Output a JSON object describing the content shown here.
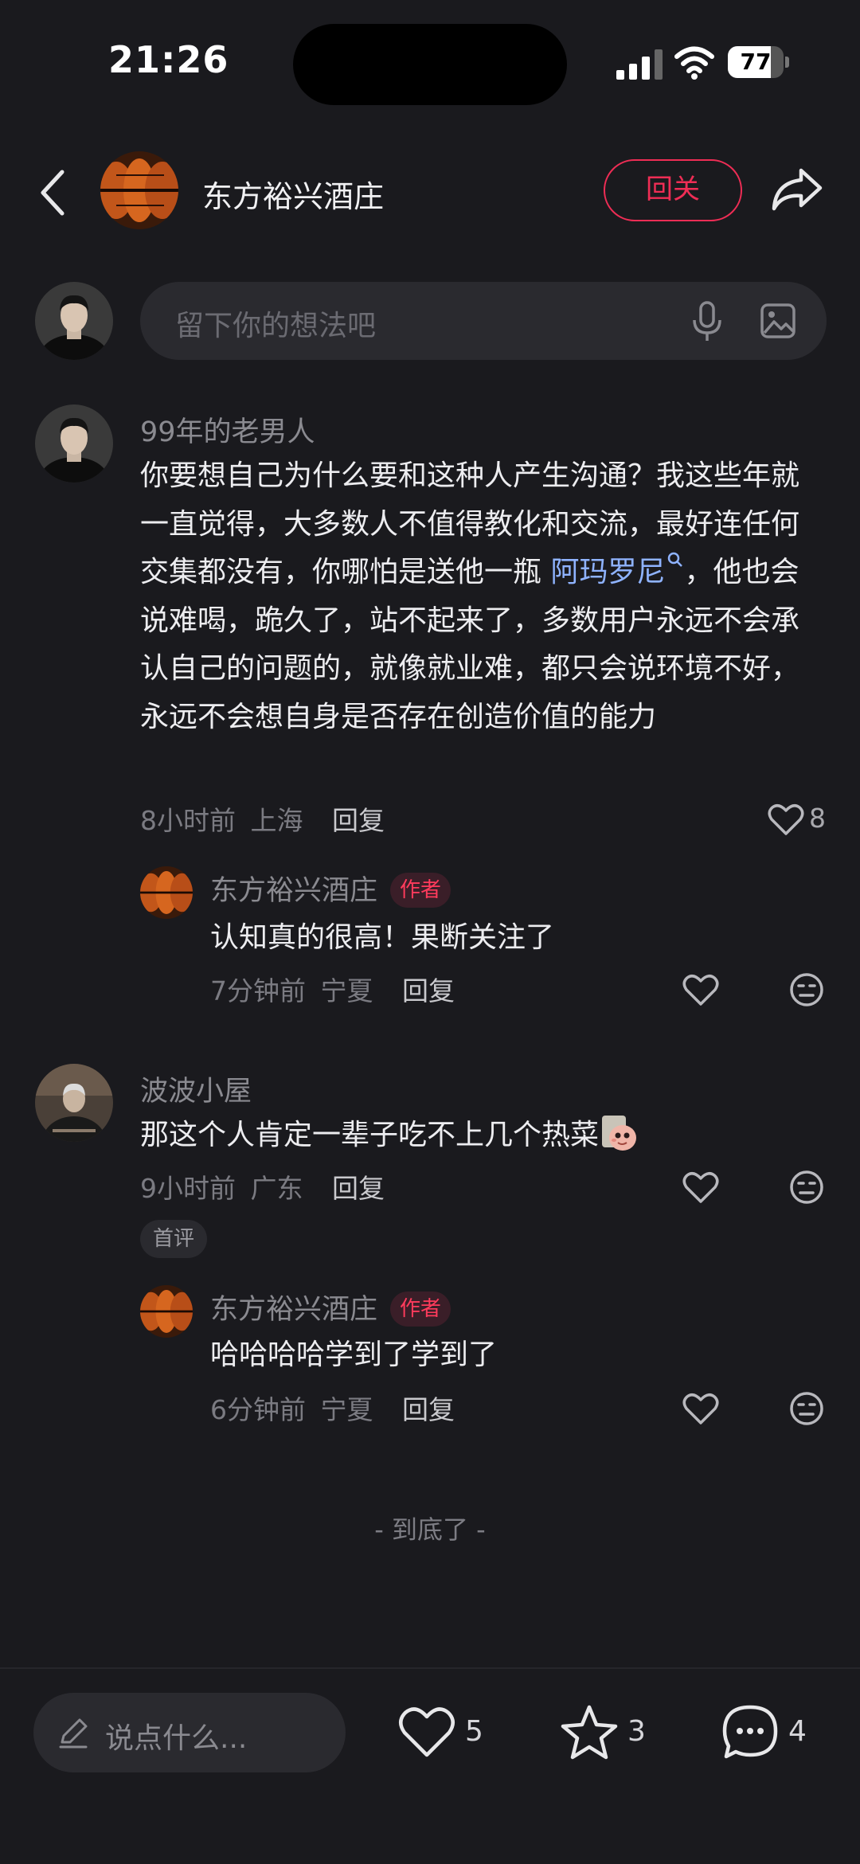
{
  "status": {
    "time": "21:26",
    "battery": "77",
    "battery_level": 0.77
  },
  "header": {
    "shop_name": "东方裕兴酒庄",
    "follow_label": "回关"
  },
  "composer": {
    "placeholder": "留下你的想法吧"
  },
  "comments": [
    {
      "user": "99年的老男人",
      "text_before": "你要想自己为什么要和这种人产生沟通？我这些年就一直觉得，大多数人不值得教化和交流，最好连任何交集都没有，你哪怕是送他一瓶 ",
      "mention": "阿玛罗尼",
      "text_after": "，他也会说难喝，跪久了，站不起来了，多数用户永远不会承认自己的问题的，就像就业难，都只会说环境不好，永远不会想自身是否存在创造价值的能力",
      "time": "8小时前",
      "location": "上海",
      "reply_label": "回复",
      "likes": "8",
      "reply": {
        "user": "东方裕兴酒庄",
        "tag": "作者",
        "text": "认知真的很高！果断关注了",
        "time": "7分钟前",
        "location": "宁夏",
        "reply_label": "回复"
      }
    },
    {
      "user": "波波小屋",
      "text": "那这个人肯定一辈子吃不上几个热菜",
      "time": "9小时前",
      "location": "广东",
      "reply_label": "回复",
      "tag": "首评",
      "reply": {
        "user": "东方裕兴酒庄",
        "tag": "作者",
        "text": "哈哈哈哈学到了学到了",
        "time": "6分钟前",
        "location": "宁夏",
        "reply_label": "回复"
      }
    }
  ],
  "end_text": "- 到底了 -",
  "bottom_bar": {
    "input_placeholder": "说点什么...",
    "likes": "5",
    "stars": "3",
    "comments": "4"
  }
}
